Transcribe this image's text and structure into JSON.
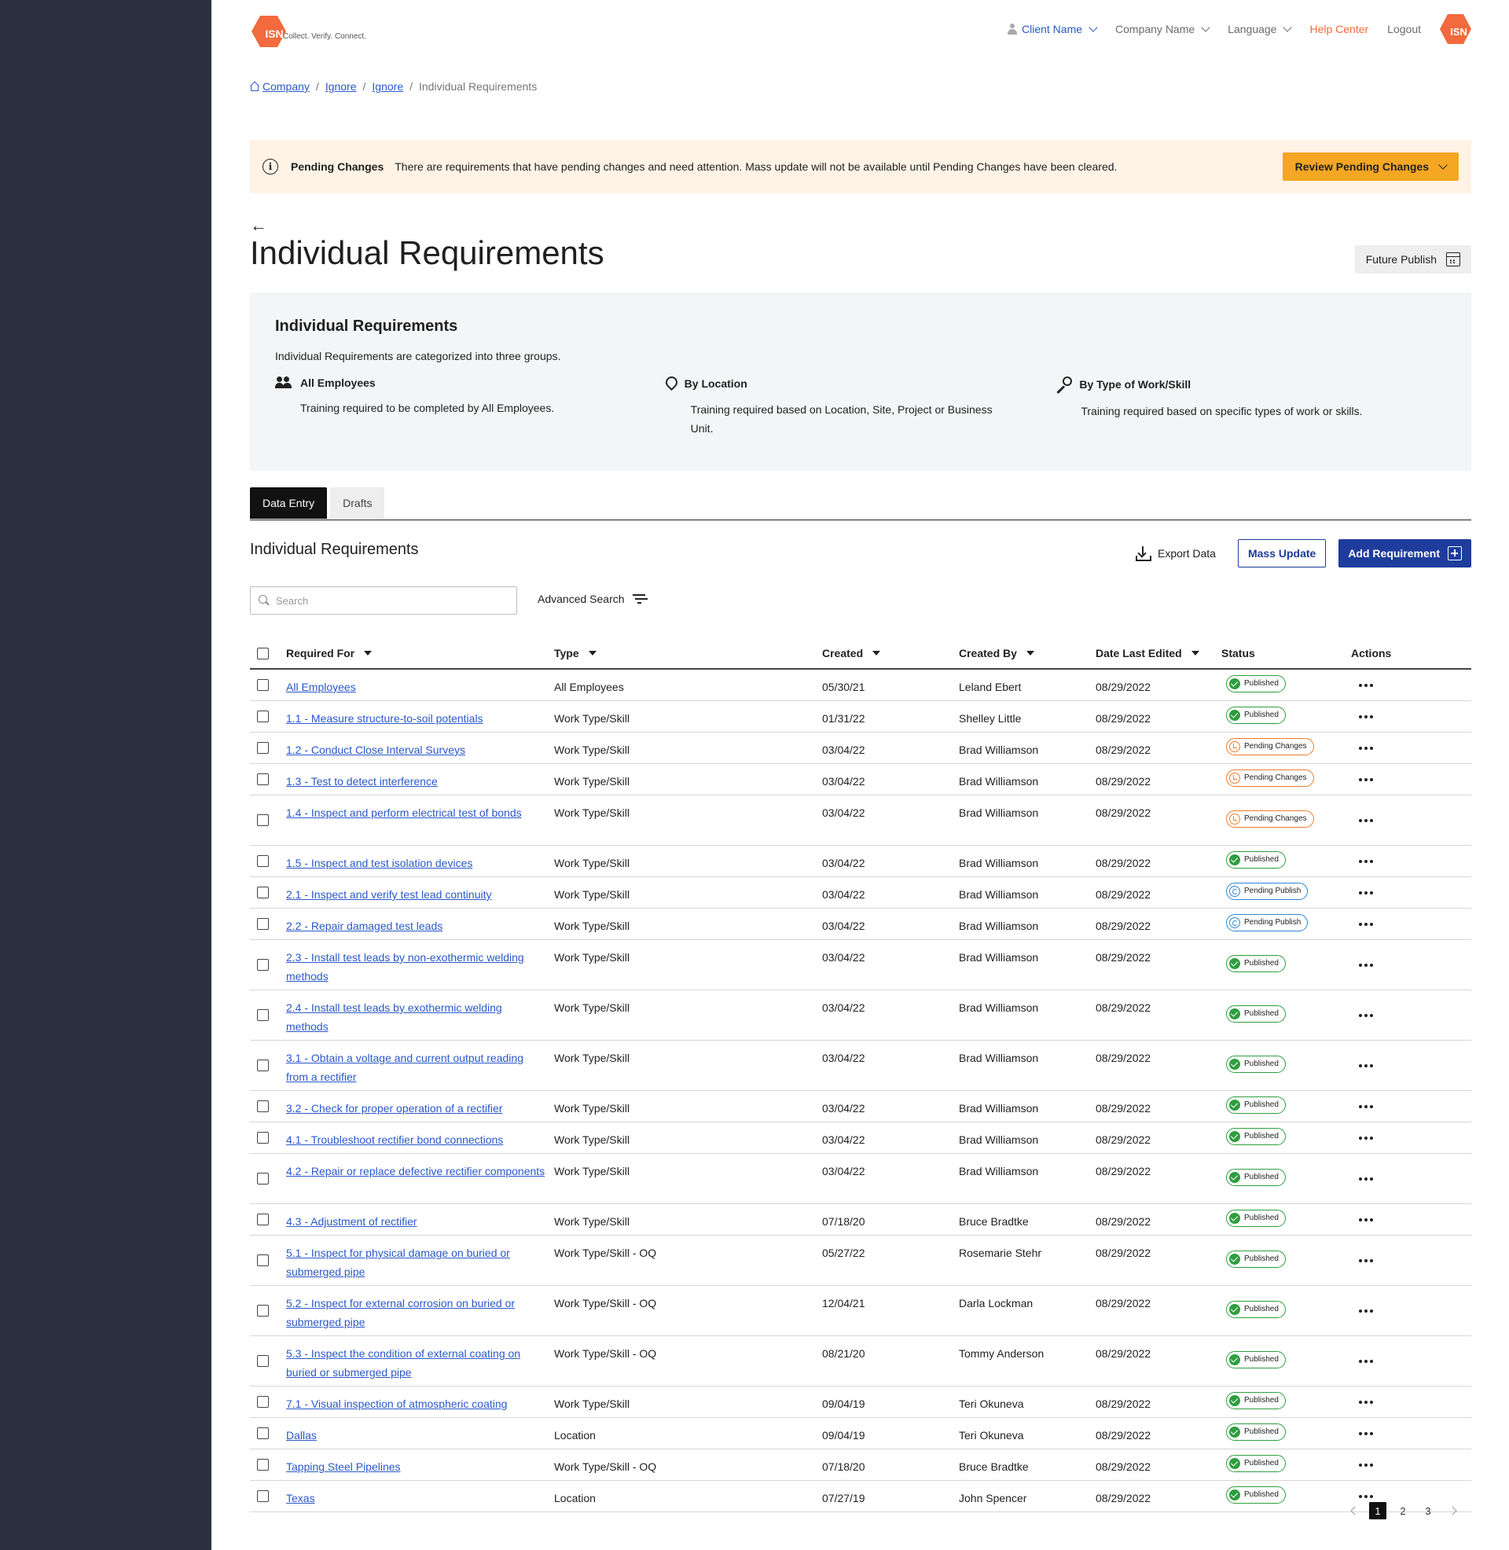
{
  "brand": {
    "logo_text": "ISN",
    "tagline": "Collect. Verify. Connect.",
    "accent": "#f26a3d"
  },
  "topnav": {
    "client": "Client Name",
    "company": "Company Name",
    "language": "Language",
    "help": "Help Center",
    "logout": "Logout",
    "avatar_text": "ISN"
  },
  "breadcrumb": {
    "home": "Company",
    "crumb1": "Ignore",
    "crumb2": "Ignore",
    "current": "Individual Requirements"
  },
  "alert": {
    "title": "Pending Changes",
    "message": "There are requirements that have pending changes and need attention. Mass update will not be available until Pending Changes have been cleared.",
    "button": "Review Pending Changes"
  },
  "page": {
    "back_arrow": "←",
    "title": "Individual Requirements",
    "future_publish": "Future Publish"
  },
  "info": {
    "title": "Individual Requirements",
    "description": "Individual Requirements are categorized into three groups.",
    "groups": [
      {
        "title": "All Employees",
        "text": "Training required to be completed by All Employees.",
        "icon": "people-icon"
      },
      {
        "title": "By Location",
        "text": "Training required based on Location, Site, Project or Business Unit.",
        "icon": "location-pin-icon"
      },
      {
        "title": "By Type of Work/Skill",
        "text": "Training required based on specific types of work or skills.",
        "icon": "wrench-icon"
      }
    ]
  },
  "tabs": [
    "Data Entry",
    "Drafts"
  ],
  "section": {
    "title": "Individual Requirements",
    "export": "Export Data",
    "mass_update": "Mass Update",
    "add": "Add Requirement",
    "search_placeholder": "Search",
    "advanced_search": "Advanced Search"
  },
  "table": {
    "columns": [
      "Required For",
      "Type",
      "Created",
      "Created By",
      "Date Last Edited",
      "Status",
      "Actions"
    ],
    "rows": [
      {
        "req": "All Employees",
        "type": "All Employees",
        "created": "05/30/21",
        "by": "Leland Ebert",
        "edited": "08/29/2022",
        "status": "Published",
        "status_kind": "published"
      },
      {
        "req": "1.1 - Measure structure-to-soil potentials",
        "type": "Work Type/Skill",
        "created": "01/31/22",
        "by": "Shelley Little",
        "edited": "08/29/2022",
        "status": "Published",
        "status_kind": "published"
      },
      {
        "req": "1.2 - Conduct Close Interval Surveys",
        "type": "Work Type/Skill",
        "created": "03/04/22",
        "by": "Brad Williamson",
        "edited": "08/29/2022",
        "status": "Pending Changes",
        "status_kind": "pending-changes"
      },
      {
        "req": "1.3 - Test to detect interference",
        "type": "Work Type/Skill",
        "created": "03/04/22",
        "by": "Brad Williamson",
        "edited": "08/29/2022",
        "status": "Pending Changes",
        "status_kind": "pending-changes"
      },
      {
        "req": "1.4 - Inspect and perform electrical test of bonds",
        "type": "Work Type/Skill",
        "created": "03/04/22",
        "by": "Brad Williamson",
        "edited": "08/29/2022",
        "status": "Pending Changes",
        "status_kind": "pending-changes"
      },
      {
        "req": "1.5 - Inspect and test isolation devices",
        "type": "Work Type/Skill",
        "created": "03/04/22",
        "by": "Brad Williamson",
        "edited": "08/29/2022",
        "status": "Published",
        "status_kind": "published"
      },
      {
        "req": "2.1 - Inspect and verify test lead continuity",
        "type": "Work Type/Skill",
        "created": "03/04/22",
        "by": "Brad Williamson",
        "edited": "08/29/2022",
        "status": "Pending Publish",
        "status_kind": "pending-publish"
      },
      {
        "req": "2.2 - Repair damaged test leads",
        "type": "Work Type/Skill",
        "created": "03/04/22",
        "by": "Brad Williamson",
        "edited": "08/29/2022",
        "status": "Pending Publish",
        "status_kind": "pending-publish"
      },
      {
        "req": "2.3 - Install test leads by non-exothermic welding methods",
        "type": "Work Type/Skill",
        "created": "03/04/22",
        "by": "Brad Williamson",
        "edited": "08/29/2022",
        "status": "Published",
        "status_kind": "published"
      },
      {
        "req": "2.4 - Install test leads by exothermic welding methods",
        "type": "Work Type/Skill",
        "created": "03/04/22",
        "by": "Brad Williamson",
        "edited": "08/29/2022",
        "status": "Published",
        "status_kind": "published"
      },
      {
        "req": "3.1 - Obtain a voltage and current output reading from a rectifier",
        "type": "Work Type/Skill",
        "created": "03/04/22",
        "by": "Brad Williamson",
        "edited": "08/29/2022",
        "status": "Published",
        "status_kind": "published"
      },
      {
        "req": "3.2 - Check for proper operation of a rectifier",
        "type": "Work Type/Skill",
        "created": "03/04/22",
        "by": "Brad Williamson",
        "edited": "08/29/2022",
        "status": "Published",
        "status_kind": "published"
      },
      {
        "req": "4.1 - Troubleshoot rectifier bond connections",
        "type": "Work Type/Skill",
        "created": "03/04/22",
        "by": "Brad Williamson",
        "edited": "08/29/2022",
        "status": "Published",
        "status_kind": "published"
      },
      {
        "req": "4.2 - Repair or replace defective rectifier components",
        "type": "Work Type/Skill",
        "created": "03/04/22",
        "by": "Brad Williamson",
        "edited": "08/29/2022",
        "status": "Published",
        "status_kind": "published"
      },
      {
        "req": "4.3 - Adjustment of rectifier",
        "type": "Work Type/Skill",
        "created": "07/18/20",
        "by": "Bruce Bradtke",
        "edited": "08/29/2022",
        "status": "Published",
        "status_kind": "published"
      },
      {
        "req": "5.1 - Inspect for physical damage on buried or submerged pipe",
        "type": "Work Type/Skill - OQ",
        "created": "05/27/22",
        "by": "Rosemarie Stehr",
        "edited": "08/29/2022",
        "status": "Published",
        "status_kind": "published"
      },
      {
        "req": "5.2 - Inspect for external corrosion on buried or submerged pipe",
        "type": "Work Type/Skill - OQ",
        "created": "12/04/21",
        "by": "Darla Lockman",
        "edited": "08/29/2022",
        "status": "Published",
        "status_kind": "published"
      },
      {
        "req": "5.3 - Inspect the condition of external coating on buried or submerged pipe",
        "type": "Work Type/Skill - OQ",
        "created": "08/21/20",
        "by": "Tommy Anderson",
        "edited": "08/29/2022",
        "status": "Published",
        "status_kind": "published"
      },
      {
        "req": "7.1 - Visual inspection of atmospheric coating",
        "type": "Work Type/Skill",
        "created": "09/04/19",
        "by": "Teri Okuneva",
        "edited": "08/29/2022",
        "status": "Published",
        "status_kind": "published"
      },
      {
        "req": "Dallas",
        "type": "Location",
        "created": "09/04/19",
        "by": "Teri Okuneva",
        "edited": "08/29/2022",
        "status": "Published",
        "status_kind": "published"
      },
      {
        "req": "Tapping Steel Pipelines",
        "type": "Work Type/Skill - OQ",
        "created": "07/18/20",
        "by": "Bruce Bradtke",
        "edited": "08/29/2022",
        "status": "Published",
        "status_kind": "published"
      },
      {
        "req": "Texas",
        "type": "Location",
        "created": "07/27/19",
        "by": "John Spencer",
        "edited": "08/29/2022",
        "status": "Published",
        "status_kind": "published"
      }
    ]
  },
  "pagination": {
    "pages": [
      "1",
      "2",
      "3"
    ],
    "current": "1"
  },
  "colors": {
    "primary": "#1e3c9c",
    "link": "#2a58c9",
    "published": "#2e9e3e",
    "pending_changes": "#ef7d2a",
    "pending_publish": "#2f86d4",
    "alert_bg": "#fff3e6",
    "review_button": "#f5a623",
    "sidebar": "#2b313f"
  }
}
